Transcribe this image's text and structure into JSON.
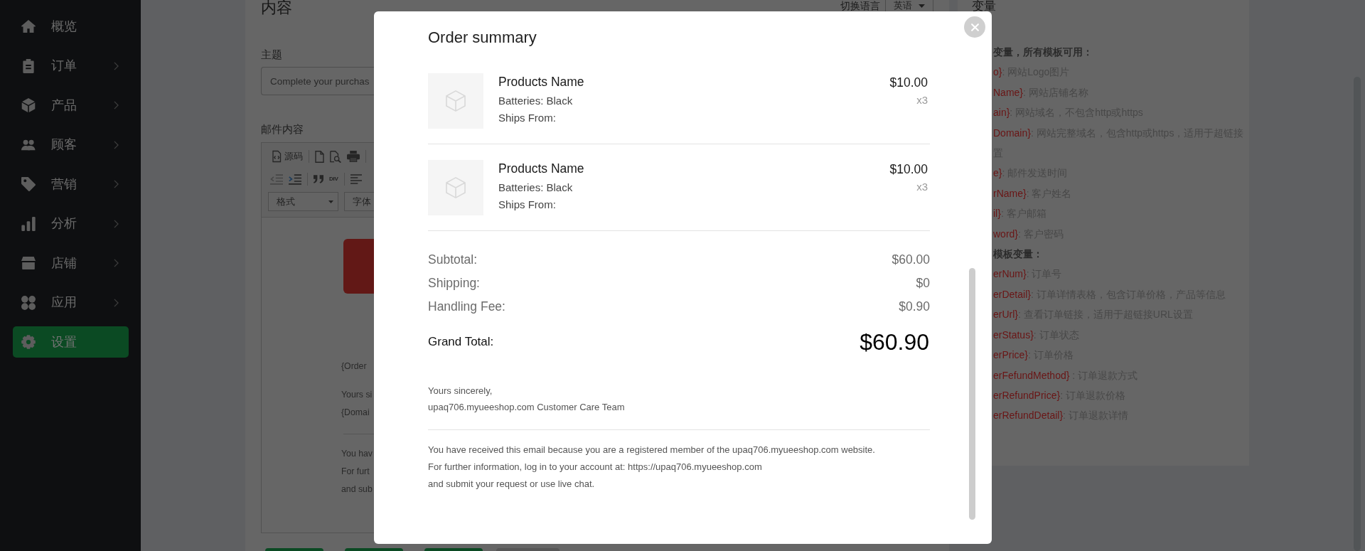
{
  "sidebar": {
    "items": [
      {
        "label": "概览",
        "kind": "link",
        "selected": false
      },
      {
        "label": "订单",
        "kind": "menu",
        "selected": false
      },
      {
        "label": "产品",
        "kind": "menu",
        "selected": false
      },
      {
        "label": "顾客",
        "kind": "menu",
        "selected": false
      },
      {
        "label": "营销",
        "kind": "menu",
        "selected": false
      },
      {
        "label": "分析",
        "kind": "menu",
        "selected": false
      },
      {
        "label": "店铺",
        "kind": "menu",
        "selected": false
      },
      {
        "label": "应用",
        "kind": "menu",
        "selected": false
      },
      {
        "label": "设置",
        "kind": "link",
        "selected": true
      }
    ]
  },
  "content_panel": {
    "title": "内容",
    "language_label": "切换语言",
    "language_select": "英语",
    "subject_label": "主题",
    "subject_value": "Complete your purchas",
    "body_label": "邮件内容",
    "editor": {
      "source_button": "源码",
      "outdent_disabled": true,
      "div_button": "DIV",
      "format_select": "格式",
      "font_select": "字体",
      "blocks": [
        {
          "kind": "banner"
        },
        {
          "kind": "text",
          "lines": [
            "{Order"
          ]
        },
        {
          "kind": "text",
          "lines": [
            "Yours si",
            "{Domai"
          ]
        },
        {
          "kind": "rule"
        },
        {
          "kind": "text",
          "lines": [
            "You hav",
            "For furt",
            "and sub"
          ]
        }
      ]
    },
    "action_buttons": [
      {
        "kind": "primary"
      },
      {
        "kind": "primary"
      },
      {
        "kind": "primary"
      },
      {
        "kind": "secondary"
      }
    ]
  },
  "variables_panel": {
    "title": "变量",
    "lines": [
      {
        "kind": "heading",
        "text": "变量，所有模板可用："
      },
      {
        "kind": "variable",
        "name": "o}",
        "description": ": 网站Logo图片"
      },
      {
        "kind": "variable",
        "name": "Name}",
        "description": ": 网站店铺名称"
      },
      {
        "kind": "variable",
        "name": "ain}",
        "description": ": 网站域名，不包含http或https"
      },
      {
        "kind": "variable",
        "name": "Domain}",
        "description": ": 网站完整域名，包含http或https，适用于超链接"
      },
      {
        "kind": "text",
        "text": "置"
      },
      {
        "kind": "variable",
        "name": "e}",
        "description": ": 邮件发送时间"
      },
      {
        "kind": "variable",
        "name": "rName}",
        "description": ": 客户姓名"
      },
      {
        "kind": "variable",
        "name": "il}",
        "description": ": 客户邮箱"
      },
      {
        "kind": "variable",
        "name": "word}",
        "description": ": 客户密码"
      },
      {
        "kind": "heading",
        "text": "模板变量："
      },
      {
        "kind": "variable",
        "name": "erNum}",
        "description": ": 订单号"
      },
      {
        "kind": "variable",
        "name": "erDetail}",
        "description": ": 订单详情表格，包含订单价格，产品等信息"
      },
      {
        "kind": "variable",
        "name": "erUrl}",
        "description": ": 查看订单链接，适用于超链接URL设置"
      },
      {
        "kind": "variable",
        "name": "erStatus}",
        "description": ": 订单状态"
      },
      {
        "kind": "variable",
        "name": "erPrice}",
        "description": ": 订单价格"
      },
      {
        "kind": "variable",
        "name": "erFefundMethod}",
        "description": " : 订单退款方式"
      },
      {
        "kind": "variable",
        "name": "erRefundPrice}",
        "description": ": 订单退款价格"
      },
      {
        "kind": "variable",
        "name": "erRefundDetail}",
        "description": ": 订单退款详情"
      }
    ]
  },
  "dialog": {
    "title": "Order summary",
    "products": [
      {
        "name": "Products Name",
        "attributes": [
          "Batteries: Black",
          "Ships From:"
        ],
        "price": "$10.00",
        "quantity": "x3"
      },
      {
        "name": "Products Name",
        "attributes": [
          "Batteries: Black",
          "Ships From:"
        ],
        "price": "$10.00",
        "quantity": "x3"
      }
    ],
    "summary": [
      {
        "label": "Subtotal:",
        "value": "$60.00"
      },
      {
        "label": "Shipping:",
        "value": "$0"
      },
      {
        "label": "Handling Fee:",
        "value": "$0.90"
      }
    ],
    "grand_total": {
      "label": "Grand Total:",
      "value": "$60.90"
    },
    "signature": [
      "Yours sincerely,",
      "upaq706.myueeshop.com Customer Care Team"
    ],
    "footer": [
      {
        "text": "You have received this email because you are a registered member of the upaq706.myueeshop.com website."
      },
      {
        "text": "For further information, log in to your account at: ",
        "link": "https://upaq706.myueeshop.com"
      },
      {
        "text": "and submit your request or use live chat."
      }
    ]
  }
}
